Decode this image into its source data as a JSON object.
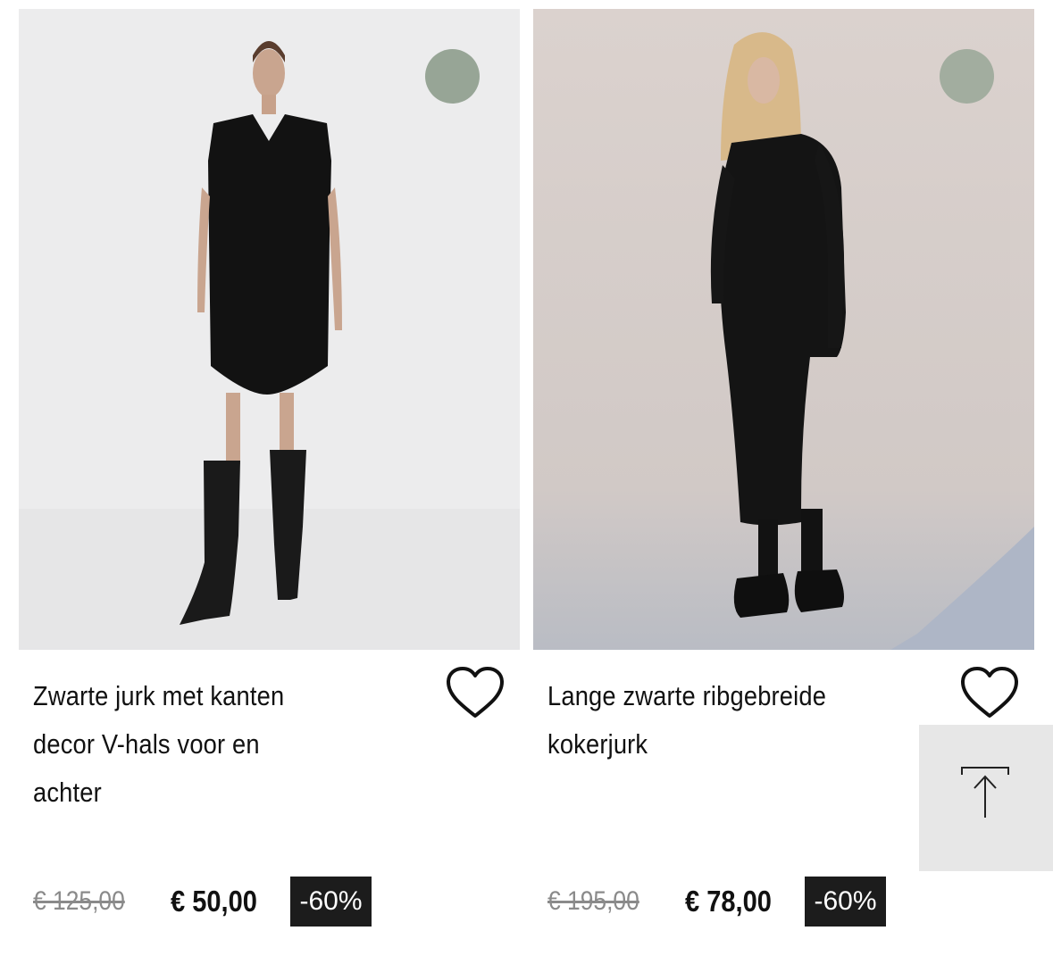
{
  "products": [
    {
      "title_lines": [
        "Zwarte jurk met kanten",
        "decor V-hals voor en",
        "achter"
      ],
      "old_price": "€ 125,00",
      "price": "€ 50,00",
      "discount": "-60%",
      "swatch_color": "#97a596",
      "photo_bg": "#ececed"
    },
    {
      "title_lines": [
        "Lange zwarte ribgebreide",
        "kokerjurk"
      ],
      "old_price": "€ 195,00",
      "price": "€ 78,00",
      "discount": "-60%",
      "swatch_color": "#a2ad9f",
      "photo_bg": "#d8cfcb"
    }
  ],
  "icons": {
    "wishlist": "heart-outline-icon",
    "scroll_top": "arrow-up-to-top-icon"
  }
}
